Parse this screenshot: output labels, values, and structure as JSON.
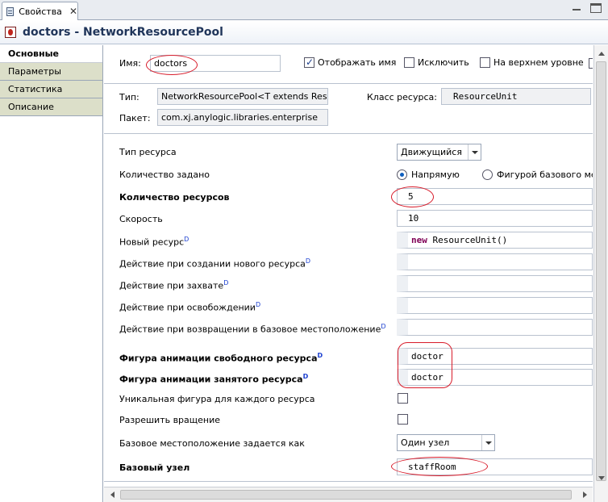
{
  "tab": {
    "title": "Свойства"
  },
  "header": {
    "title": "doctors - NetworkResourcePool"
  },
  "sidebar": {
    "items": [
      {
        "label": "Основные"
      },
      {
        "label": "Параметры"
      },
      {
        "label": "Статистика"
      },
      {
        "label": "Описание"
      }
    ]
  },
  "general": {
    "name_label": "Имя:",
    "name_value": "doctors",
    "show_name": {
      "label": "Отображать имя",
      "checked": true
    },
    "exclude": {
      "label": "Исключить",
      "checked": false
    },
    "top_level": {
      "label": "На верхнем уровне",
      "checked": false
    }
  },
  "type_section": {
    "type_label": "Тип:",
    "type_value": "NetworkResourcePool<T extends Reso",
    "resource_class_label": "Класс ресурса:",
    "resource_class_value": "ResourceUnit",
    "package_label": "Пакет:",
    "package_value": "com.xj.anylogic.libraries.enterprise"
  },
  "props": {
    "resource_type": {
      "label": "Тип ресурса",
      "value": "Движущийся"
    },
    "quantity_by": {
      "label": "Количество задано",
      "option1": "Напрямую",
      "option2": "Фигурой базового ме",
      "selected": "option1"
    },
    "count": {
      "label": "Количество ресурсов",
      "value": "5"
    },
    "speed": {
      "label": "Скорость",
      "value": "10"
    },
    "new_resource": {
      "label": "Новый ресурс",
      "sup": "D",
      "keyword": "new",
      "value": " ResourceUnit()"
    },
    "on_create": {
      "label": "Действие при создании нового ресурса",
      "sup": "D"
    },
    "on_seize": {
      "label": "Действие при захвате",
      "sup": "D"
    },
    "on_release": {
      "label": "Действие при освобождении",
      "sup": "D"
    },
    "on_return": {
      "label": "Действие при возвращении в базовое местоположение",
      "sup": "D"
    },
    "idle_shape": {
      "label": "Фигура анимации свободного ресурса",
      "sup": "D",
      "value": "doctor"
    },
    "busy_shape": {
      "label": "Фигура анимации занятого ресурса",
      "sup": "D",
      "value": "doctor"
    },
    "unique_shape": {
      "label": "Уникальная фигура для каждого ресурса",
      "checked": false
    },
    "allow_rotation": {
      "label": "Разрешить вращение",
      "checked": false
    },
    "home_location_by": {
      "label": "Базовое местоположение задается как",
      "value": "Один узел"
    },
    "home_node": {
      "label": "Базовый узел",
      "value": "staffRoom"
    }
  },
  "colors": {
    "annotation_oval": "#d81b2a",
    "keyword": "#7f0055",
    "sup": "#1b3fd0",
    "header_title": "#20355a"
  }
}
